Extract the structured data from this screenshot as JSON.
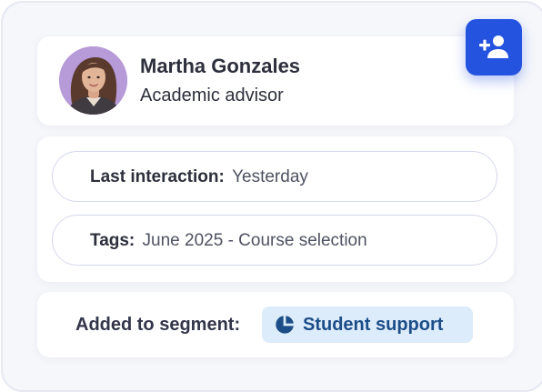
{
  "profile": {
    "name": "Martha Gonzales",
    "role": "Academic advisor"
  },
  "details": {
    "last_interaction_label": "Last interaction:",
    "last_interaction_value": "Yesterday",
    "tags_label": "Tags:",
    "tags_value": "June 2025 - Course selection"
  },
  "segment": {
    "label": "Added to segment:",
    "chip_label": "Student support",
    "chip_icon": "pie-chart-icon"
  },
  "actions": {
    "add_icon": "person-add-icon"
  },
  "colors": {
    "accent": "#2453e0",
    "chip_background": "#dcecfb",
    "chip_text": "#1c4d88",
    "avatar_background": "#b79ad8"
  }
}
